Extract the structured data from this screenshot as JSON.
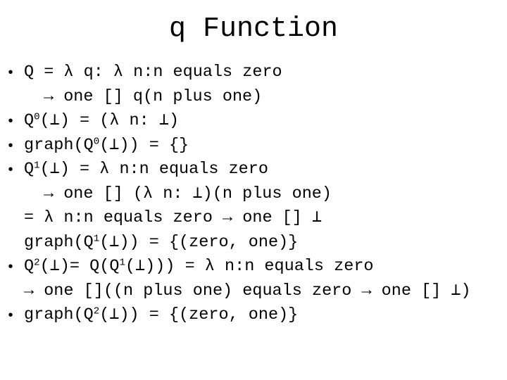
{
  "title": "q Function",
  "lines": [
    {
      "bullet": "•",
      "indent": 0,
      "parts": [
        "Q = λ q: λ n:n equals zero"
      ]
    },
    {
      "bullet": "",
      "indent": 1,
      "parts": [
        "→ one [] q(n plus one)"
      ]
    },
    {
      "bullet": "•",
      "indent": 0,
      "parts": [
        "Q",
        "0",
        "(⊥) = (λ n: ⊥)"
      ]
    },
    {
      "bullet": "•",
      "indent": 0,
      "parts": [
        "graph(Q",
        "0",
        "(⊥)) = {}"
      ]
    },
    {
      "bullet": "•",
      "indent": 0,
      "parts": [
        "Q",
        "1",
        "(⊥) = λ n:n equals zero"
      ]
    },
    {
      "bullet": "",
      "indent": 1,
      "parts": [
        "→ one [] (λ n: ⊥)(n plus one)"
      ]
    },
    {
      "bullet": "",
      "indent": 0,
      "parts": [
        "= λ n:n equals zero → one [] ⊥"
      ]
    },
    {
      "bullet": "",
      "indent": 0,
      "parts": [
        "graph(Q",
        "1",
        "(⊥)) = {(zero, one)}"
      ]
    },
    {
      "bullet": "•",
      "indent": 0,
      "parts": [
        "Q",
        "2",
        "(⊥)= Q(Q",
        "1",
        "(⊥))) = λ n:n equals zero"
      ]
    },
    {
      "bullet": "",
      "indent": 0,
      "parts": [
        "→ one []((n plus one) equals zero → one [] ⊥)"
      ]
    },
    {
      "bullet": "•",
      "indent": 0,
      "parts": [
        "graph(Q",
        "2",
        "(⊥)) = {(zero, one)}"
      ]
    }
  ]
}
